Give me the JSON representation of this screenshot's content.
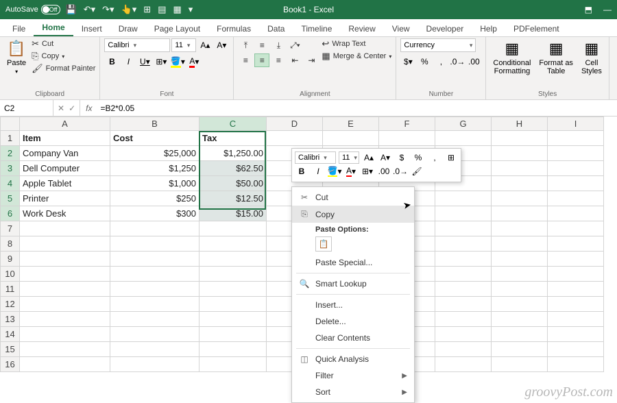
{
  "title": "Book1 - Excel",
  "autosave": {
    "label": "AutoSave",
    "state": "Off"
  },
  "tabs": [
    "File",
    "Home",
    "Insert",
    "Draw",
    "Page Layout",
    "Formulas",
    "Data",
    "Timeline",
    "Review",
    "View",
    "Developer",
    "Help",
    "PDFelement"
  ],
  "activeTab": 1,
  "ribbon": {
    "clipboard": {
      "paste": "Paste",
      "cut": "Cut",
      "copy": "Copy",
      "painter": "Format Painter",
      "label": "Clipboard"
    },
    "font": {
      "name": "Calibri",
      "size": "11",
      "label": "Font"
    },
    "alignment": {
      "wrap": "Wrap Text",
      "merge": "Merge & Center",
      "label": "Alignment"
    },
    "number": {
      "format": "Currency",
      "label": "Number"
    },
    "styles": {
      "cond": "Conditional\nFormatting",
      "table": "Format as\nTable",
      "cell": "Cell\nStyles",
      "label": "Styles"
    }
  },
  "formulaBar": {
    "ref": "C2",
    "formula": "=B2*0.05"
  },
  "columns": [
    "A",
    "B",
    "C",
    "D",
    "E",
    "F",
    "G",
    "H",
    "I"
  ],
  "headers": {
    "a": "Item",
    "b": "Cost",
    "c": "Tax"
  },
  "rows": [
    {
      "item": "Company Van",
      "cost": "$25,000",
      "tax": "$1,250.00"
    },
    {
      "item": "Dell Computer",
      "cost": "$1,250",
      "tax": "$62.50"
    },
    {
      "item": "Apple Tablet",
      "cost": "$1,000",
      "tax": "$50.00"
    },
    {
      "item": "Printer",
      "cost": "$250",
      "tax": "$12.50"
    },
    {
      "item": "Work Desk",
      "cost": "$300",
      "tax": "$15.00"
    }
  ],
  "miniToolbar": {
    "font": "Calibri",
    "size": "11"
  },
  "contextMenu": {
    "cut": "Cut",
    "copy": "Copy",
    "pasteHdr": "Paste Options:",
    "pasteSpecial": "Paste Special...",
    "smartLookup": "Smart Lookup",
    "insert": "Insert...",
    "delete": "Delete...",
    "clear": "Clear Contents",
    "quick": "Quick Analysis",
    "filter": "Filter",
    "sort": "Sort"
  },
  "watermark": "groovyPost.com"
}
